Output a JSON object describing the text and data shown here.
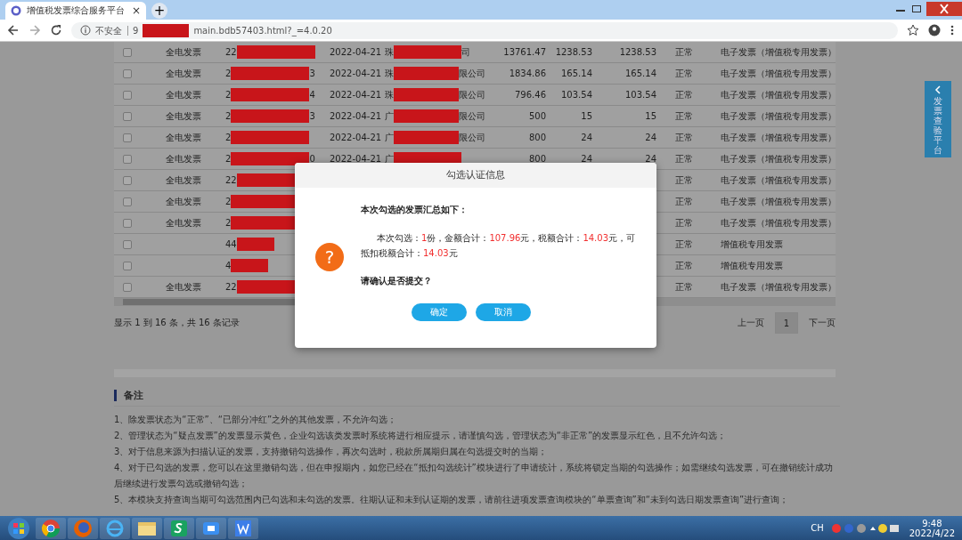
{
  "browser": {
    "tab_title": "增值税发票综合服务平台",
    "tab_close": "×",
    "new_tab": "+",
    "security": "不安全",
    "url_prefix": "9",
    "url_suffix": "main.bdb57403.html?_=4.0.20"
  },
  "table": {
    "rows": [
      {
        "checked": false,
        "type": "全电发票",
        "code_prefix": "22",
        "code_suffix": "",
        "date": "2022-04-21",
        "seller_prefix": "珠",
        "seller_suffix": "司",
        "amount": "13761.47",
        "tax": "1238.53",
        "valid_tax": "1238.53",
        "status": "正常",
        "kind": "电子发票（增值税专用发票）"
      },
      {
        "checked": false,
        "type": "全电发票",
        "code_prefix": "2",
        "code_suffix": "3",
        "date": "2022-04-21",
        "seller_prefix": "珠",
        "seller_suffix": "限公司",
        "amount": "1834.86",
        "tax": "165.14",
        "valid_tax": "165.14",
        "status": "正常",
        "kind": "电子发票（增值税专用发票）"
      },
      {
        "checked": false,
        "type": "全电发票",
        "code_prefix": "2",
        "code_suffix": "4",
        "date": "2022-04-21",
        "seller_prefix": "珠",
        "seller_suffix": "限公司",
        "amount": "796.46",
        "tax": "103.54",
        "valid_tax": "103.54",
        "status": "正常",
        "kind": "电子发票（增值税专用发票）"
      },
      {
        "checked": false,
        "type": "全电发票",
        "code_prefix": "2",
        "code_suffix": "3",
        "date": "2022-04-21",
        "seller_prefix": "广",
        "seller_suffix": "限公司",
        "amount": "500",
        "tax": "15",
        "valid_tax": "15",
        "status": "正常",
        "kind": "电子发票（增值税专用发票）"
      },
      {
        "checked": false,
        "type": "全电发票",
        "code_prefix": "2",
        "code_suffix": "",
        "date": "2022-04-21",
        "seller_prefix": "广",
        "seller_suffix": "限公司",
        "amount": "800",
        "tax": "24",
        "valid_tax": "24",
        "status": "正常",
        "kind": "电子发票（增值税专用发票）"
      },
      {
        "checked": false,
        "type": "全电发票",
        "code_prefix": "2",
        "code_suffix": "0",
        "date": "2022-04-21",
        "seller_prefix": "广",
        "seller_suffix": "",
        "amount": "800",
        "tax": "24",
        "valid_tax": "24",
        "status": "正常",
        "kind": "电子发票（增值税专用发票）"
      },
      {
        "checked": false,
        "type": "全电发票",
        "code_prefix": "22",
        "status": "正常",
        "kind": "电子发票（增值税专用发票）"
      },
      {
        "checked": false,
        "type": "全电发票",
        "code_prefix": "2",
        "status": "正常",
        "kind": "电子发票（增值税专用发票）"
      },
      {
        "checked": false,
        "type": "全电发票",
        "code_prefix": "2",
        "status": "正常",
        "kind": "电子发票（增值税专用发票）"
      },
      {
        "checked": false,
        "code_prefix": "44",
        "status": "正常",
        "kind": "增值税专用发票"
      },
      {
        "checked": false,
        "code_prefix": "4",
        "status": "正常",
        "kind": "增值税专用发票"
      },
      {
        "checked": false,
        "type": "全电发票",
        "code_prefix": "22",
        "status": "正常",
        "kind": "电子发票（增值税专用发票）"
      }
    ]
  },
  "pager": {
    "summary": "显示 1 到 16 条，共 16 条记录",
    "prev": "上一页",
    "pages": [
      {
        "label": "1",
        "selected": true
      }
    ],
    "next": "下一页"
  },
  "side_tab": {
    "label": "发票查验平台"
  },
  "notes": {
    "title": "备注",
    "items": [
      "1、除发票状态为“正常”、“已部分冲红”之外的其他发票，不允许勾选；",
      "2、管理状态为“疑点发票”的发票显示黄色，企业勾选该类发票时系统将进行相应提示，请谨慎勾选，管理状态为“非正常”的发票显示红色，且不允许勾选；",
      "3、对于信息来源为扫描认证的发票，支持撤销勾选操作，再次勾选时，税款所属期归属在勾选提交时的当期；",
      "4、对于已勾选的发票，您可以在这里撤销勾选，但在申报期内，如您已经在“抵扣勾选统计”模块进行了申请统计，系统将锁定当期的勾选操作；如需继续勾选发票，可在撤销统计成功后继续进行发票勾选或撤销勾选；",
      "5、本模块支持查询当期可勾选范围内已勾选和未勾选的发票。往期认证和未到认证期的发票，请前往进项发票查询模块的“单票查询”和“未到勾选日期发票查询”进行查询；"
    ]
  },
  "dialog": {
    "title": "勾选认证信息",
    "icon_glyph": "?",
    "heading": "本次勾选的发票汇总如下：",
    "summary": [
      {
        "text": "本次勾选：",
        "highlight": false
      },
      {
        "text": "1",
        "highlight": true
      },
      {
        "text": "份，金额合计：",
        "highlight": false
      },
      {
        "text": "107.96",
        "highlight": true
      },
      {
        "text": "元，税额合计：",
        "highlight": false
      },
      {
        "text": "14.03",
        "highlight": true
      },
      {
        "text": "元，可抵扣税额合计：",
        "highlight": false
      },
      {
        "text": "14.03",
        "highlight": true
      },
      {
        "text": "元",
        "highlight": false
      }
    ],
    "question": "请确认是否提交？",
    "buttons": [
      "确定",
      "取消"
    ]
  },
  "taskbar": {
    "lang": "CH",
    "time": "9:48",
    "date": "2022/4/22"
  }
}
